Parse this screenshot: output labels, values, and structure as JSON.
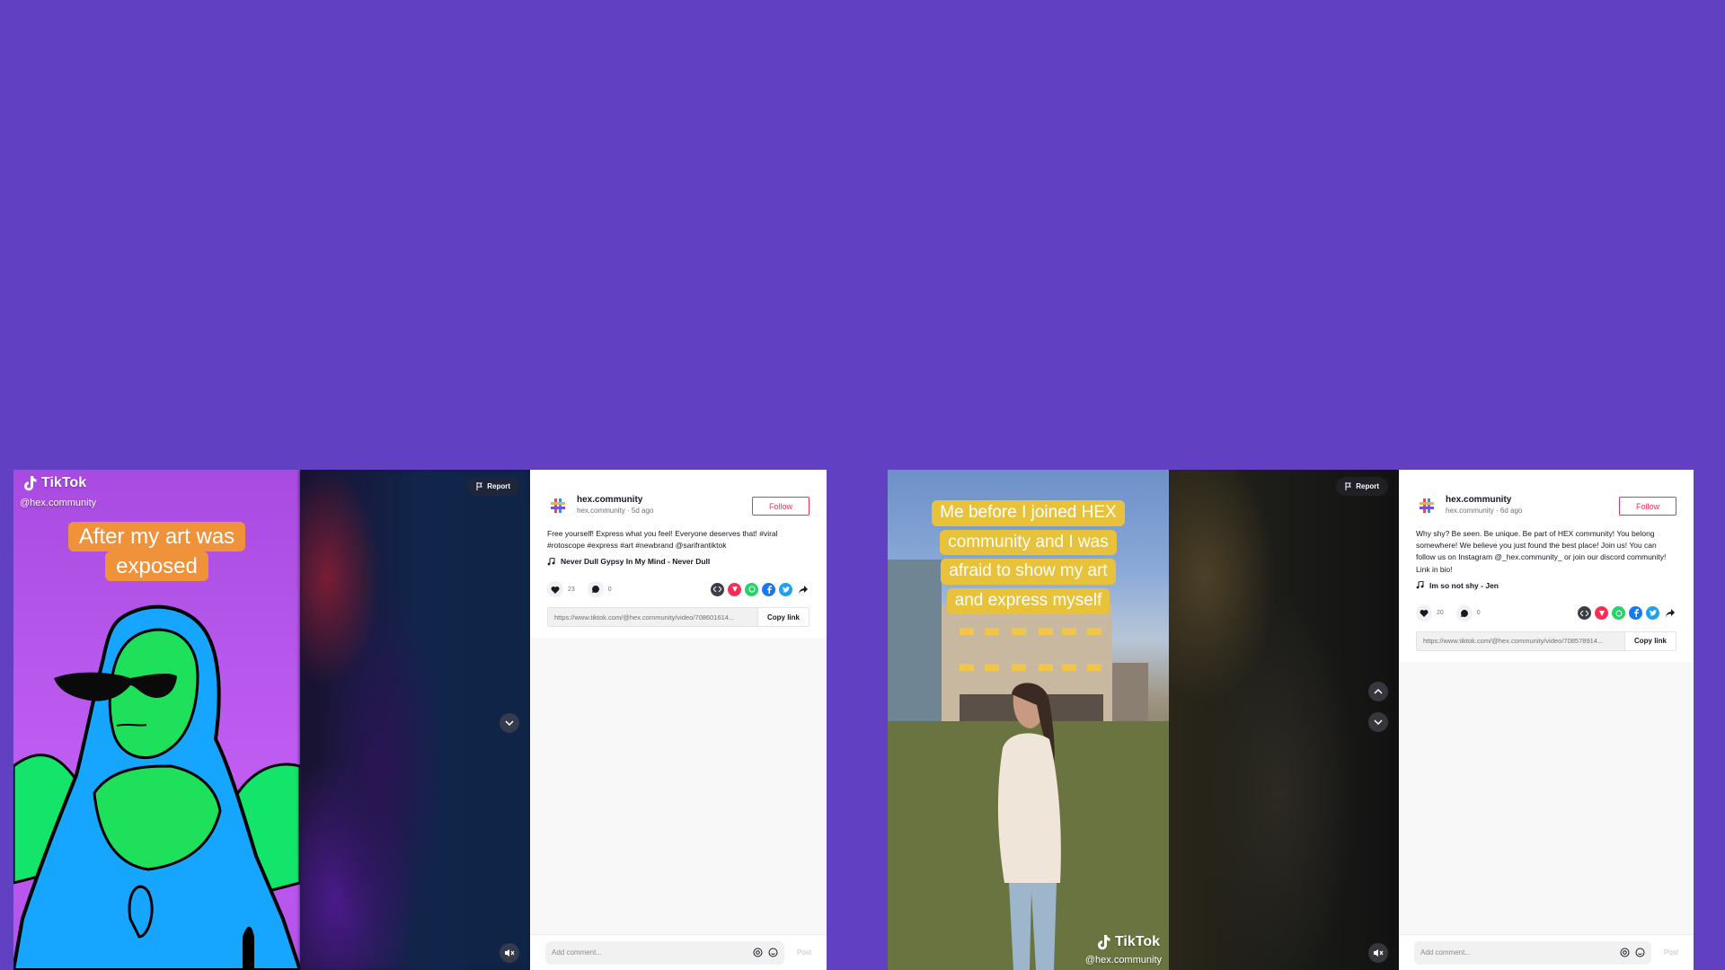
{
  "colors": {
    "page_bg": "#6141c2",
    "follow": "#fe2c55",
    "caption_orange": "#f0923a",
    "caption_yellow": "#e9c23b"
  },
  "cards": [
    {
      "video": {
        "brand": "TikTok",
        "handle": "@hex.community",
        "caption_lines": [
          "After my art was",
          "exposed"
        ],
        "report_label": "Report",
        "nav": [
          "chevron-down-icon"
        ]
      },
      "author": {
        "name": "hex.community",
        "sub": "hex.community · 5d ago"
      },
      "follow_label": "Follow",
      "description": "Free yourself! Express what you feel! Everyone deserves that! #viral #rotoscope #express #art #newbrand @sarifrantiktok",
      "music": "Never Dull Gypsy In My Mind - Never Dull",
      "likes": "23",
      "comments": "0",
      "link": "https://www.tiktok.com/@hex.community/video/708601614...",
      "copy_label": "Copy link",
      "comment_placeholder": "Add comment...",
      "post_label": "Post"
    },
    {
      "video": {
        "brand": "TikTok",
        "handle": "@hex.community",
        "caption_lines": [
          "Me before I joined HEX",
          "community and I was",
          "afraid to show my art",
          "and express myself"
        ],
        "report_label": "Report",
        "nav": [
          "chevron-up-icon",
          "chevron-down-icon"
        ]
      },
      "author": {
        "name": "hex.community",
        "sub": "hex.community · 6d ago"
      },
      "follow_label": "Follow",
      "description": "Why shy? Be seen. Be unique. Be part of HEX community! You belong somewhere! We believe you just found the best place! Join us! You can follow us on Instagram @_hex.community_ or join our discord community! Link in bio!",
      "music": "Im so not shy - Jen",
      "likes": "20",
      "comments": "0",
      "link": "https://www.tiktok.com/@hex.community/video/708578914...",
      "copy_label": "Copy link",
      "comment_placeholder": "Add comment...",
      "post_label": "Post"
    }
  ]
}
